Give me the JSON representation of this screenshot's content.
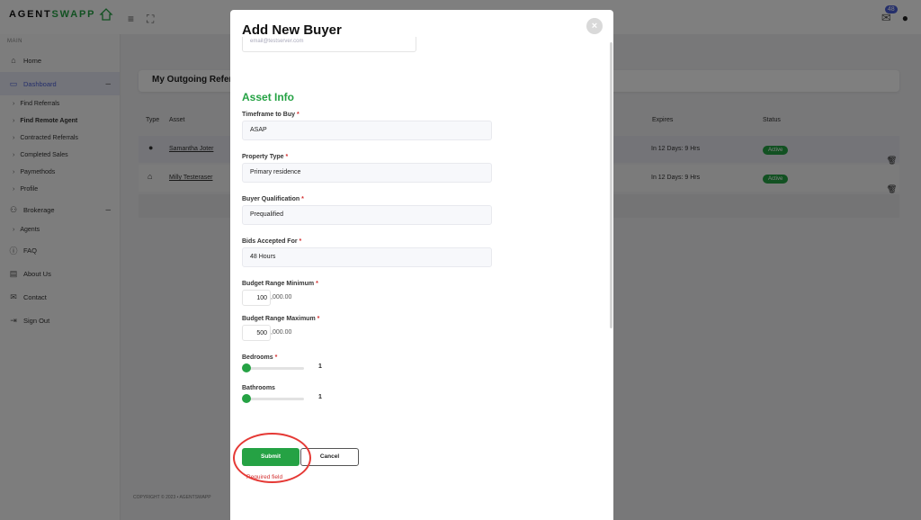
{
  "brand": {
    "name_pre": "AGENT",
    "name_post": "SWAPP"
  },
  "header": {
    "notifications_count": "48"
  },
  "sidebar": {
    "section_label": "MAIN",
    "items": [
      {
        "label": "Home",
        "icon": "home-icon"
      },
      {
        "label": "Dashboard",
        "icon": "monitor-icon"
      },
      {
        "label": "Brokerage",
        "icon": "people-icon"
      },
      {
        "label": "FAQ",
        "icon": "info-icon"
      },
      {
        "label": "About Us",
        "icon": "archive-icon"
      },
      {
        "label": "Contact",
        "icon": "mail-icon"
      },
      {
        "label": "Sign Out",
        "icon": "sign-out-icon"
      }
    ],
    "dashboard_sub": [
      "Find Referrals",
      "Find Remote Agent",
      "Contracted Referrals",
      "Completed Sales",
      "Paymethods",
      "Profile"
    ],
    "brokerage_sub": [
      "Agents"
    ]
  },
  "main": {
    "card_title": "My Outgoing Refer",
    "table_headers": {
      "type": "Type",
      "asset": "Asset",
      "expires": "Expires",
      "status": "Status"
    },
    "rows": [
      {
        "asset": "Samantha Joter",
        "expires": "In 12 Days: 9 Hrs",
        "status": "Active"
      },
      {
        "asset": "Milly Testeraser",
        "expires": "In 12 Days: 9 Hrs",
        "status": "Active"
      }
    ],
    "footer": "COPYRIGHT © 2023 • AGENTSWAPP"
  },
  "modal": {
    "title": "Add New Buyer",
    "email_placeholder": "email@testserver.com",
    "section_title": "Asset Info",
    "timeframe": {
      "label": "Timeframe to Buy",
      "value": "ASAP"
    },
    "property_type": {
      "label": "Property Type",
      "value": "Primary residence"
    },
    "qualification": {
      "label": "Buyer Qualification",
      "value": "Prequalified"
    },
    "bids": {
      "label": "Bids Accepted For",
      "value": "48 Hours"
    },
    "budget_min": {
      "label": "Budget Range Minimum",
      "value": "100",
      "suffix": ",000.00"
    },
    "budget_max": {
      "label": "Budget Range Maximum",
      "value": "500",
      "suffix": ",000.00"
    },
    "bedrooms": {
      "label": "Bedrooms",
      "value": "1"
    },
    "bathrooms": {
      "label": "Bathrooms",
      "value": "1"
    },
    "submit_label": "Submit",
    "cancel_label": "Cancel",
    "error_text": "Required field",
    "required_mark": "*"
  },
  "colors": {
    "accent_green": "#25a244",
    "accent_blue": "#4a5fd6",
    "error_red": "#d32f2f"
  }
}
